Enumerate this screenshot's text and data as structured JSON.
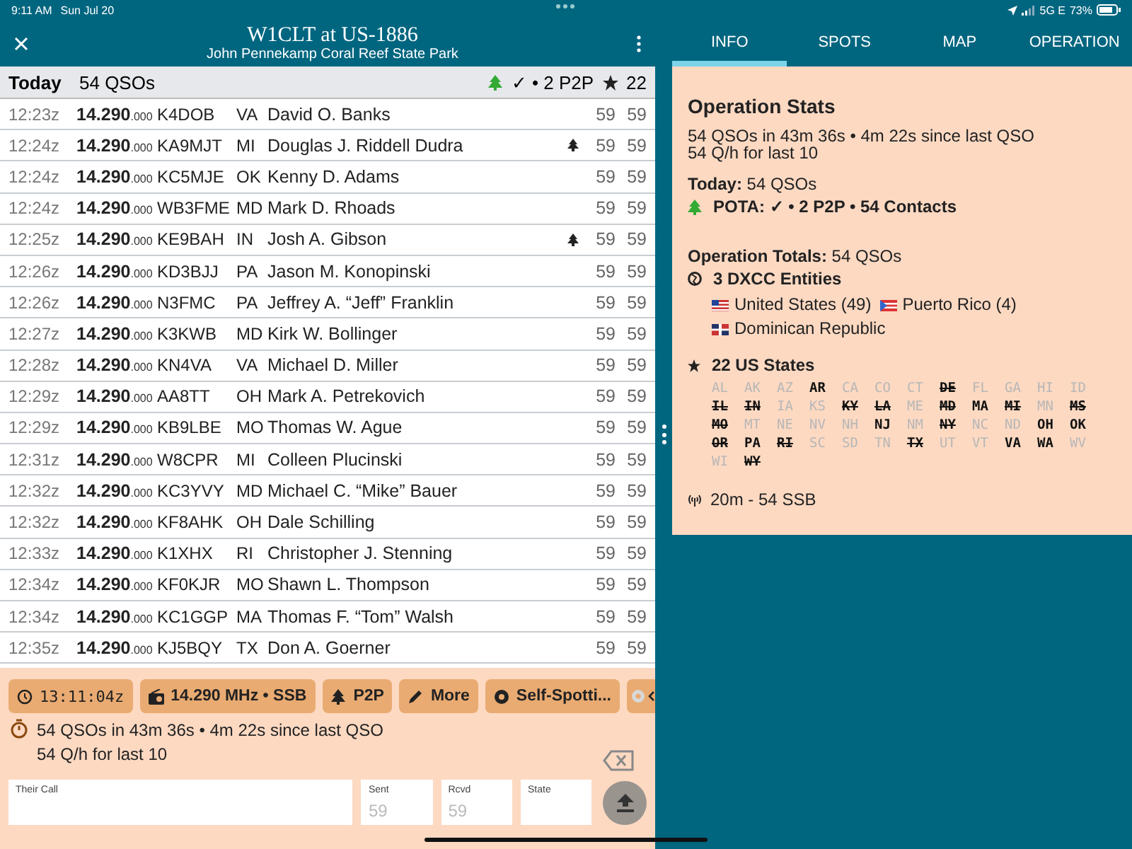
{
  "status_bar": {
    "time": "9:11 AM",
    "date": "Sun Jul 20",
    "network": "5G E",
    "battery": "73%"
  },
  "header": {
    "title": "W1CLT at US-1886",
    "subtitle": "John Pennekamp Coral Reef State Park"
  },
  "summary": {
    "label": "Today",
    "count": "54 QSOs",
    "pota": "✓ • 2 P2P",
    "states": "22"
  },
  "qsos": [
    {
      "time": "12:23z",
      "freq": "14.290",
      "freq_fraction": ".000",
      "call": "K4DOB",
      "state": "VA",
      "name": "David O. Banks",
      "p2p": false,
      "sent": "59",
      "rcvd": "59"
    },
    {
      "time": "12:24z",
      "freq": "14.290",
      "freq_fraction": ".000",
      "call": "KA9MJT",
      "state": "MI",
      "name": "Douglas J. Riddell Dudra",
      "p2p": true,
      "sent": "59",
      "rcvd": "59"
    },
    {
      "time": "12:24z",
      "freq": "14.290",
      "freq_fraction": ".000",
      "call": "KC5MJE",
      "state": "OK",
      "name": "Kenny D. Adams",
      "p2p": false,
      "sent": "59",
      "rcvd": "59"
    },
    {
      "time": "12:24z",
      "freq": "14.290",
      "freq_fraction": ".000",
      "call": "WB3FME",
      "state": "MD",
      "name": "Mark D. Rhoads",
      "p2p": false,
      "sent": "59",
      "rcvd": "59"
    },
    {
      "time": "12:25z",
      "freq": "14.290",
      "freq_fraction": ".000",
      "call": "KE9BAH",
      "state": "IN",
      "name": "Josh A. Gibson",
      "p2p": true,
      "sent": "59",
      "rcvd": "59"
    },
    {
      "time": "12:26z",
      "freq": "14.290",
      "freq_fraction": ".000",
      "call": "KD3BJJ",
      "state": "PA",
      "name": "Jason M. Konopinski",
      "p2p": false,
      "sent": "59",
      "rcvd": "59"
    },
    {
      "time": "12:26z",
      "freq": "14.290",
      "freq_fraction": ".000",
      "call": "N3FMC",
      "state": "PA",
      "name": "Jeffrey A. “Jeff” Franklin",
      "p2p": false,
      "sent": "59",
      "rcvd": "59"
    },
    {
      "time": "12:27z",
      "freq": "14.290",
      "freq_fraction": ".000",
      "call": "K3KWB",
      "state": "MD",
      "name": "Kirk W. Bollinger",
      "p2p": false,
      "sent": "59",
      "rcvd": "59"
    },
    {
      "time": "12:28z",
      "freq": "14.290",
      "freq_fraction": ".000",
      "call": "KN4VA",
      "state": "VA",
      "name": "Michael D. Miller",
      "p2p": false,
      "sent": "59",
      "rcvd": "59"
    },
    {
      "time": "12:29z",
      "freq": "14.290",
      "freq_fraction": ".000",
      "call": "AA8TT",
      "state": "OH",
      "name": "Mark A. Petrekovich",
      "p2p": false,
      "sent": "59",
      "rcvd": "59"
    },
    {
      "time": "12:29z",
      "freq": "14.290",
      "freq_fraction": ".000",
      "call": "KB9LBE",
      "state": "MO",
      "name": "Thomas W. Ague",
      "p2p": false,
      "sent": "59",
      "rcvd": "59"
    },
    {
      "time": "12:31z",
      "freq": "14.290",
      "freq_fraction": ".000",
      "call": "W8CPR",
      "state": "MI",
      "name": "Colleen Plucinski",
      "p2p": false,
      "sent": "59",
      "rcvd": "59"
    },
    {
      "time": "12:32z",
      "freq": "14.290",
      "freq_fraction": ".000",
      "call": "KC3YVY",
      "state": "MD",
      "name": "Michael C. “Mike” Bauer",
      "p2p": false,
      "sent": "59",
      "rcvd": "59"
    },
    {
      "time": "12:32z",
      "freq": "14.290",
      "freq_fraction": ".000",
      "call": "KF8AHK",
      "state": "OH",
      "name": "Dale Schilling",
      "p2p": false,
      "sent": "59",
      "rcvd": "59"
    },
    {
      "time": "12:33z",
      "freq": "14.290",
      "freq_fraction": ".000",
      "call": "K1XHX",
      "state": "RI",
      "name": "Christopher J. Stenning",
      "p2p": false,
      "sent": "59",
      "rcvd": "59"
    },
    {
      "time": "12:34z",
      "freq": "14.290",
      "freq_fraction": ".000",
      "call": "KF0KJR",
      "state": "MO",
      "name": "Shawn L. Thompson",
      "p2p": false,
      "sent": "59",
      "rcvd": "59"
    },
    {
      "time": "12:34z",
      "freq": "14.290",
      "freq_fraction": ".000",
      "call": "KC1GGP",
      "state": "MA",
      "name": "Thomas F. “Tom” Walsh",
      "p2p": false,
      "sent": "59",
      "rcvd": "59"
    },
    {
      "time": "12:35z",
      "freq": "14.290",
      "freq_fraction": ".000",
      "call": "KJ5BQY",
      "state": "TX",
      "name": "Don A. Goerner",
      "p2p": false,
      "sent": "59",
      "rcvd": "59"
    }
  ],
  "toolbar": [
    {
      "kind": "clock",
      "label": "13:11:04z"
    },
    {
      "kind": "radio",
      "label": "14.290 MHz • SSB"
    },
    {
      "kind": "tree",
      "label": "P2P"
    },
    {
      "kind": "pencil",
      "label": "More"
    },
    {
      "kind": "spot",
      "label": "Self-Spotti..."
    }
  ],
  "rate": {
    "line1": "54 QSOs in 43m 36s • 4m 22s since last QSO",
    "line2": "54 Q/h for last 10"
  },
  "fields": [
    {
      "label": "Their Call"
    },
    {
      "label": "Sent",
      "placeholder": "59"
    },
    {
      "label": "Rcvd",
      "placeholder": "59"
    },
    {
      "label": "State"
    }
  ],
  "tabs": [
    {
      "label": "INFO",
      "selected": true
    },
    {
      "label": "SPOTS",
      "selected": false
    },
    {
      "label": "MAP",
      "selected": false
    },
    {
      "label": "OPERATION",
      "selected": false
    }
  ],
  "info": {
    "title": "Operation Stats",
    "rate_line1": "54 QSOs in 43m 36s • 4m 22s since last QSO",
    "rate_line2": "54 Q/h for last 10",
    "today": "**Today:** 54 QSOs",
    "pota": "POTA: ✓ • 2 P2P • 54 Contacts",
    "totals": "**Operation Totals:** 54 QSOs",
    "dxcc": "3 DXCC Entities",
    "entities": [
      {
        "kind": "us",
        "name": "United States (49)"
      },
      {
        "kind": "pr",
        "name": "Puerto Rico (4)"
      },
      {
        "kind": "do",
        "name": "Dominican Republic"
      }
    ],
    "states_title": "22 US States",
    "states": [
      {
        "code": "AL",
        "worked": false,
        "struck": false
      },
      {
        "code": "AK",
        "worked": false,
        "struck": false
      },
      {
        "code": "AZ",
        "worked": false,
        "struck": false
      },
      {
        "code": "AR",
        "worked": true,
        "struck": false
      },
      {
        "code": "CA",
        "worked": false,
        "struck": false
      },
      {
        "code": "CO",
        "worked": false,
        "struck": false
      },
      {
        "code": "CT",
        "worked": false,
        "struck": false
      },
      {
        "code": "DE",
        "worked": true,
        "struck": true
      },
      {
        "code": "FL",
        "worked": false,
        "struck": false
      },
      {
        "code": "GA",
        "worked": false,
        "struck": false
      },
      {
        "code": "HI",
        "worked": false,
        "struck": false
      },
      {
        "code": "ID",
        "worked": false,
        "struck": false
      },
      {
        "code": "IL",
        "worked": true,
        "struck": true
      },
      {
        "code": "IN",
        "worked": true,
        "struck": true
      },
      {
        "code": "IA",
        "worked": false,
        "struck": false
      },
      {
        "code": "KS",
        "worked": false,
        "struck": false
      },
      {
        "code": "KY",
        "worked": true,
        "struck": true
      },
      {
        "code": "LA",
        "worked": true,
        "struck": true
      },
      {
        "code": "ME",
        "worked": false,
        "struck": false
      },
      {
        "code": "MD",
        "worked": true,
        "struck": true
      },
      {
        "code": "MA",
        "worked": true,
        "struck": false
      },
      {
        "code": "MI",
        "worked": true,
        "struck": true
      },
      {
        "code": "MN",
        "worked": false,
        "struck": false
      },
      {
        "code": "MS",
        "worked": true,
        "struck": true
      },
      {
        "code": "MO",
        "worked": true,
        "struck": true
      },
      {
        "code": "MT",
        "worked": false,
        "struck": false
      },
      {
        "code": "NE",
        "worked": false,
        "struck": false
      },
      {
        "code": "NV",
        "worked": false,
        "struck": false
      },
      {
        "code": "NH",
        "worked": false,
        "struck": false
      },
      {
        "code": "NJ",
        "worked": true,
        "struck": false
      },
      {
        "code": "NM",
        "worked": false,
        "struck": false
      },
      {
        "code": "NY",
        "worked": true,
        "struck": true
      },
      {
        "code": "NC",
        "worked": false,
        "struck": false
      },
      {
        "code": "ND",
        "worked": false,
        "struck": false
      },
      {
        "code": "OH",
        "worked": true,
        "struck": false
      },
      {
        "code": "OK",
        "worked": true,
        "struck": false
      },
      {
        "code": "OR",
        "worked": true,
        "struck": true
      },
      {
        "code": "PA",
        "worked": true,
        "struck": false
      },
      {
        "code": "RI",
        "worked": true,
        "struck": true
      },
      {
        "code": "SC",
        "worked": false,
        "struck": false
      },
      {
        "code": "SD",
        "worked": false,
        "struck": false
      },
      {
        "code": "TN",
        "worked": false,
        "struck": false
      },
      {
        "code": "TX",
        "worked": true,
        "struck": true
      },
      {
        "code": "UT",
        "worked": false,
        "struck": false
      },
      {
        "code": "VT",
        "worked": false,
        "struck": false
      },
      {
        "code": "VA",
        "worked": true,
        "struck": false
      },
      {
        "code": "WA",
        "worked": true,
        "struck": false
      },
      {
        "code": "WV",
        "worked": false,
        "struck": false
      },
      {
        "code": "WI",
        "worked": false,
        "struck": false
      },
      {
        "code": "WY",
        "worked": true,
        "struck": true
      }
    ],
    "bands": "20m -  54 SSB"
  }
}
